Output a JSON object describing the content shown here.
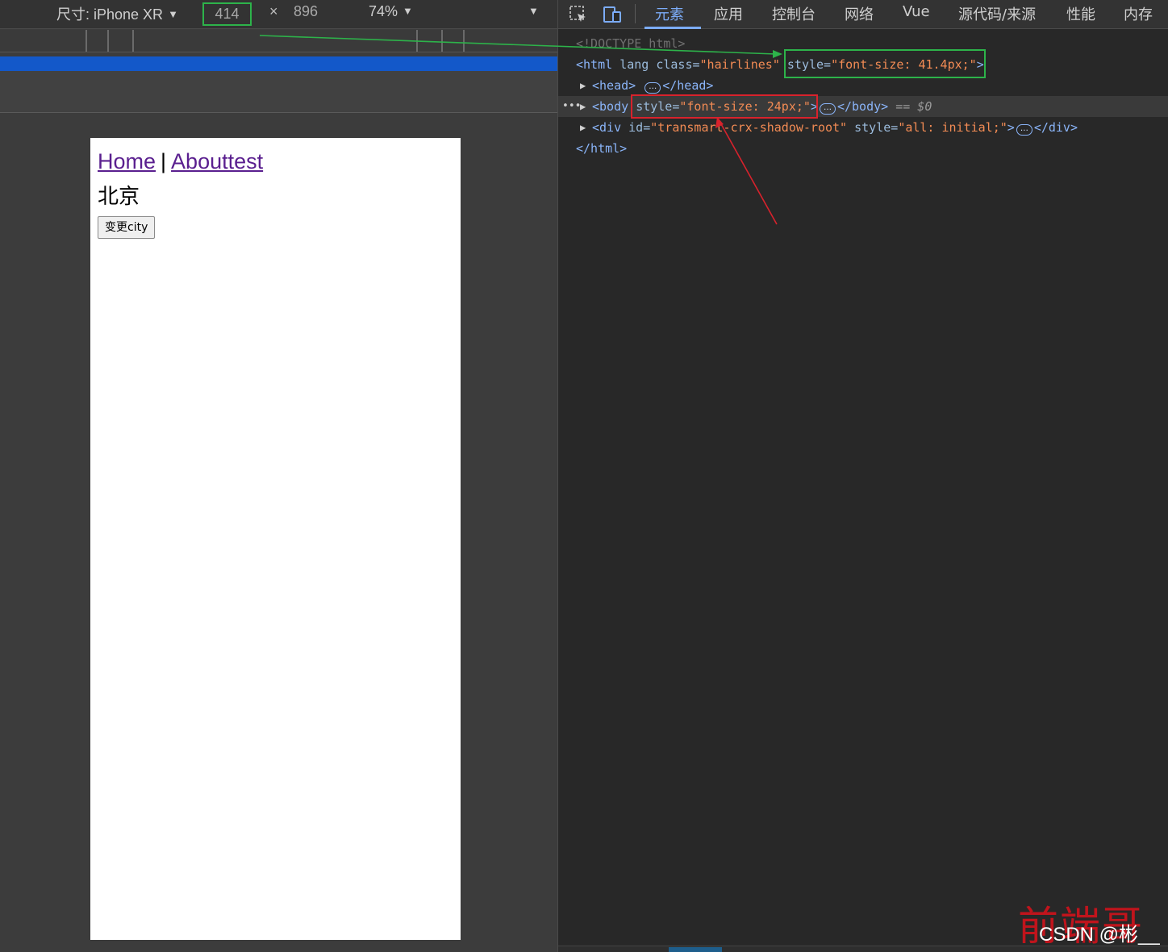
{
  "device_toolbar": {
    "device_label": "尺寸: iPhone XR",
    "width": "414",
    "times": "×",
    "height": "896",
    "zoom": "74%"
  },
  "page": {
    "nav_home": "Home",
    "nav_sep": "|",
    "nav_about": "Abouttest",
    "city": "北京",
    "change_button": "变更city"
  },
  "devtools": {
    "tabs": [
      "元素",
      "应用",
      "控制台",
      "网络",
      "Vue",
      "源代码/来源",
      "性能",
      "内存"
    ],
    "active_tab": "元素",
    "dom": {
      "doctype": "<!DOCTYPE html>",
      "html_open": "<html",
      "html_lang": "lang",
      "html_class_attr": "class=",
      "html_class_val": "\"hairlines\"",
      "html_style_attr": "style=",
      "html_style_val": "\"font-size: 41.4px;\"",
      "html_close_bracket": ">",
      "head_open": "<head>",
      "head_close": "</head>",
      "body_open": "<body",
      "body_style_attr": "style=",
      "body_style_val": "\"font-size: 24px;\"",
      "body_close_bracket": ">",
      "body_close": "</body>",
      "body_eq": "== $0",
      "div_open": "<div",
      "div_id_attr": "id=",
      "div_id_val": "\"transmart-crx-shadow-root\"",
      "div_style_attr": "style=",
      "div_style_val": "\"all: initial;\"",
      "div_close_bracket": ">",
      "div_close": "</div>",
      "html_end": "</html>"
    },
    "ellipsis": "…"
  },
  "watermark": {
    "text": "前端哥",
    "csdn": "CSDN @彬__"
  },
  "colors": {
    "green_highlight": "#2db34a",
    "red_highlight": "#d8222c",
    "media_bar": "#1358c9",
    "active_tab": "#7cacf8"
  }
}
